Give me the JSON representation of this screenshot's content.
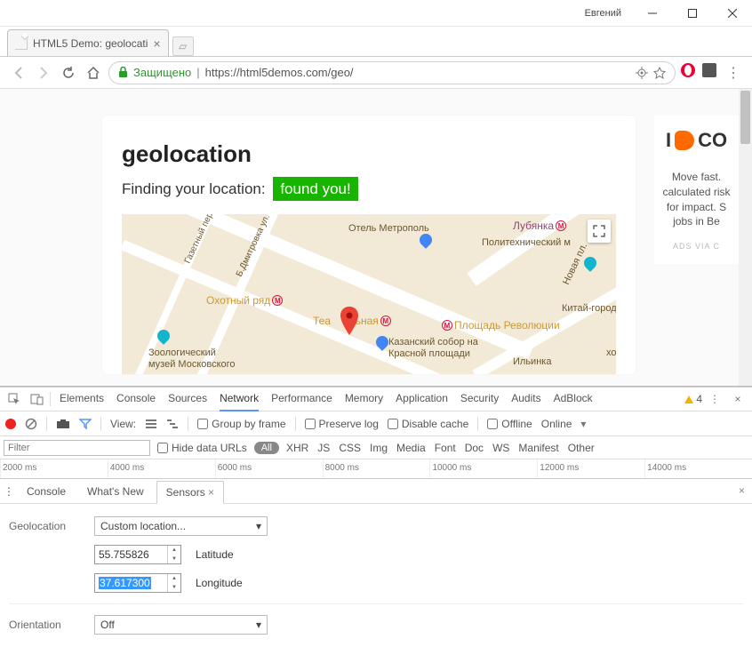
{
  "window": {
    "user": "Евгений"
  },
  "tab": {
    "title": "HTML5 Demo: geolocati"
  },
  "addressbar": {
    "secure_label": "Защищено",
    "url_display": "https://html5demos.com/geo/"
  },
  "page": {
    "heading": "geolocation",
    "status_prefix": "Finding your location:",
    "status_badge": "found you!"
  },
  "map": {
    "labels": {
      "hotel": "Отель Метрополь",
      "lubyanka": "Лубянка",
      "polytech": "Политехнический м",
      "okhotny": "Охотный ряд",
      "teatralnaya": "Театральная",
      "revolution": "Площадь Революции",
      "cathedral_l1": "Казанский собор на",
      "cathedral_l2": "Красной площади",
      "zoo_l1": "Зоологический",
      "zoo_l2": "музей Московского",
      "kitay": "Китай-город",
      "novaya": "Новая пл.",
      "ilinka": "Ильинка",
      "khoral": "хорал",
      "gazetny": "Газетный пер.",
      "dmitrovka": "Б.Дмитровка ул."
    }
  },
  "ad": {
    "brand_prefix": "I",
    "brand_suffix": "CO",
    "copy": "Move fast. calculated risk for impact. S jobs in Be",
    "via": "ADS VIA C"
  },
  "devtools": {
    "tabs": [
      "Elements",
      "Console",
      "Sources",
      "Network",
      "Performance",
      "Memory",
      "Application",
      "Security",
      "Audits",
      "AdBlock"
    ],
    "active_tab": "Network",
    "warning_count": "4",
    "network": {
      "view_label": "View:",
      "group": "Group by frame",
      "preserve": "Preserve log",
      "disable_cache": "Disable cache",
      "offline": "Offline",
      "online": "Online",
      "filter_placeholder": "Filter",
      "hide_urls": "Hide data URLs",
      "all": "All",
      "types": [
        "XHR",
        "JS",
        "CSS",
        "Img",
        "Media",
        "Font",
        "Doc",
        "WS",
        "Manifest",
        "Other"
      ],
      "ticks": [
        "2000 ms",
        "4000 ms",
        "6000 ms",
        "8000 ms",
        "10000 ms",
        "12000 ms",
        "14000 ms"
      ]
    },
    "drawer": {
      "tabs": [
        "Console",
        "What's New",
        "Sensors"
      ],
      "active": "Sensors"
    },
    "sensors": {
      "geo_label": "Geolocation",
      "geo_mode": "Custom location...",
      "lat_label": "Latitude",
      "lat_value": "55.755826",
      "lon_label": "Longitude",
      "lon_value": "37.617300",
      "orientation_label": "Orientation",
      "orientation_value": "Off"
    }
  }
}
